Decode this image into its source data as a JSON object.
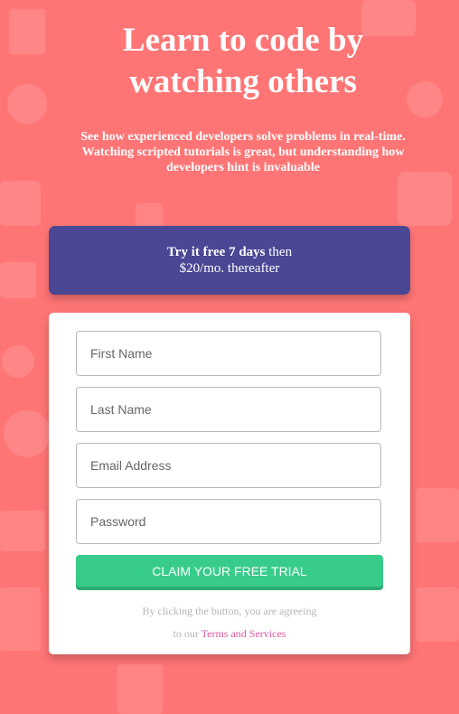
{
  "header": {
    "title_line1": "Learn to code by",
    "title_line2": "watching others",
    "subtitle_line1": "See how experienced developers solve problems in real-time.",
    "subtitle_line2": "Watching scripted tutorials is great, but understanding how developers hint is invaluable"
  },
  "trial": {
    "strong_text": "Try it free 7 days",
    "rest_text": " then",
    "price_text": "$20/mo. thereafter"
  },
  "form": {
    "first_name_placeholder": "First Name",
    "last_name_placeholder": "Last Name",
    "email_placeholder": "Email Address",
    "password_placeholder": "Password",
    "submit_label": "CLAIM YOUR FREE TRIAL",
    "legal_line1": "By clicking the button, you are agreeing",
    "legal_prefix": "to our ",
    "terms_link": "Terms and Services"
  },
  "colors": {
    "background": "#ff7575",
    "banner": "#4a4795",
    "cta": "#38cc8a",
    "link": "#e05aa0"
  }
}
